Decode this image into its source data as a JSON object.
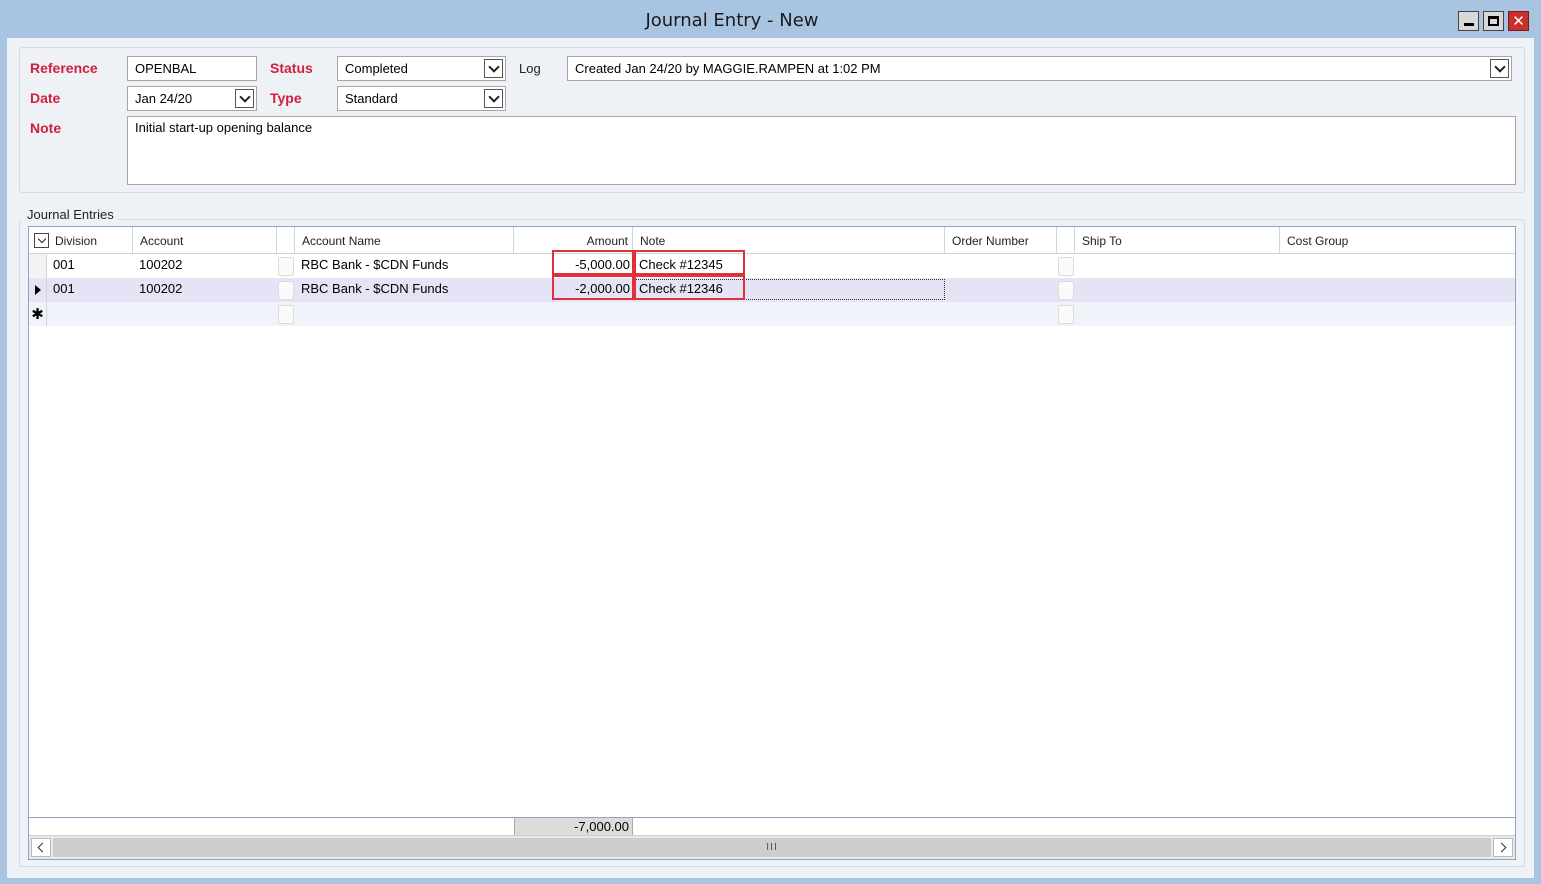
{
  "window": {
    "title": "Journal Entry - New",
    "minimize_glyph": "",
    "close_glyph": "✕"
  },
  "form": {
    "reference_label": "Reference",
    "reference_value": "OPENBAL",
    "status_label": "Status",
    "status_value": "Completed",
    "log_label": "Log",
    "log_value": "Created Jan 24/20 by MAGGIE.RAMPEN at 1:02 PM",
    "date_label": "Date",
    "date_value": "Jan 24/20",
    "type_label": "Type",
    "type_value": "Standard",
    "note_label": "Note",
    "note_value": "Initial start-up opening balance"
  },
  "entries": {
    "group_title": "Journal Entries",
    "columns": [
      "Division",
      "Account",
      "Account Name",
      "Amount",
      "Note",
      "Order Number",
      "Ship To",
      "Cost Group"
    ],
    "rows": [
      {
        "division": "001",
        "account": "100202",
        "account_name": "RBC Bank -  $CDN Funds",
        "amount": "-5,000.00",
        "note": "Check #12345",
        "order_number": "",
        "ship_to": "",
        "cost_group": "",
        "selected": false
      },
      {
        "division": "001",
        "account": "100202",
        "account_name": "RBC Bank -  $CDN Funds",
        "amount": "-2,000.00",
        "note": "Check #12346",
        "order_number": "",
        "ship_to": "",
        "cost_group": "",
        "selected": true
      }
    ],
    "new_row_marker": "✱",
    "amount_total": "-7,000.00",
    "scroll_grip": "III"
  },
  "colors": {
    "label_red": "#d21f3c",
    "highlight_red": "#e0313a",
    "title_bar": "#a9c4e0",
    "selected_row": "#e4e4f6"
  },
  "icons": [
    "minimize-icon",
    "maximize-icon",
    "close-icon",
    "chevron-down-icon",
    "row-pointer-icon",
    "new-row-star-icon",
    "chevron-left-icon",
    "chevron-right-icon"
  ]
}
